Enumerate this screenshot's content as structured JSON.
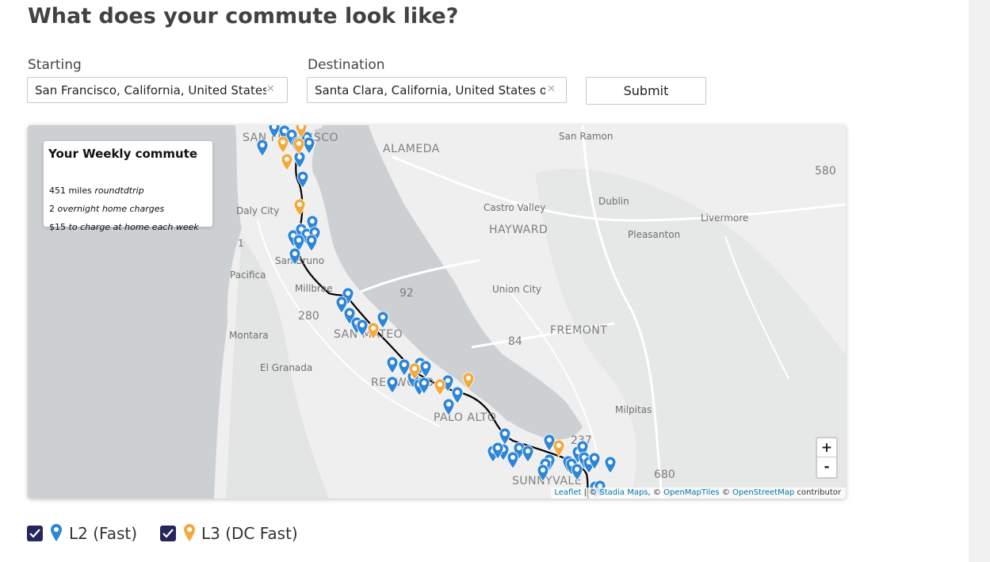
{
  "page": {
    "heading": "What does your commute look like?"
  },
  "form": {
    "starting_label": "Starting",
    "starting_value": "San Francisco, California, United States of America",
    "destination_label": "Destination",
    "destination_value": "Santa Clara, California, United States of America",
    "submit_label": "Submit"
  },
  "info_box": {
    "title": "Your Weekly commute",
    "miles_value": "451 miles",
    "miles_suffix": "roundtdtrip",
    "charges_value": "2",
    "charges_suffix": "overnight home charges",
    "cost_value": "$15",
    "cost_suffix": "to charge at home each week"
  },
  "map": {
    "labels": {
      "san_francisco": "SAN FRANCISCO",
      "alameda": "ALAMEDA",
      "san_ramon": "San Ramon",
      "dublin": "Dublin",
      "castro_valley": "Castro Valley",
      "hayward": "HAYWARD",
      "livermore": "Livermore",
      "pleasanton": "Pleasanton",
      "daly_city": "Daly City",
      "san_bruno": "San Bruno",
      "pacifica": "Pacifica",
      "millbrae": "Millbrae",
      "union_city": "Union City",
      "fremont": "FREMONT",
      "montara": "Montara",
      "san_mateo": "SAN MATEO",
      "el_granada": "El Granada",
      "redwood": "REDWOOD",
      "palo_alto": "PALO ALTO",
      "milpitas": "Milpitas",
      "sunnyvale": "SUNNYVALE",
      "r580": "580",
      "r92": "92",
      "r280": "280",
      "r84": "84",
      "r237": "237",
      "r680": "680",
      "r1": "1"
    },
    "zoom_in": "+",
    "zoom_out": "-",
    "attribution": {
      "leaflet": "Leaflet",
      "sep": "| ©",
      "stadia": "Stadia Maps",
      "mid1": ", ©",
      "omt": "OpenMapTiles",
      "mid2": "©",
      "osm": "OpenStreetMap",
      "tail": "contributor"
    },
    "l2_color": "#2e86d6",
    "l3_color": "#f3a93c",
    "route_color": "#000000"
  },
  "legend": {
    "l2_label": "L2 (Fast)",
    "l3_label": "L3 (DC Fast)",
    "l2_checked": true,
    "l3_checked": true
  }
}
